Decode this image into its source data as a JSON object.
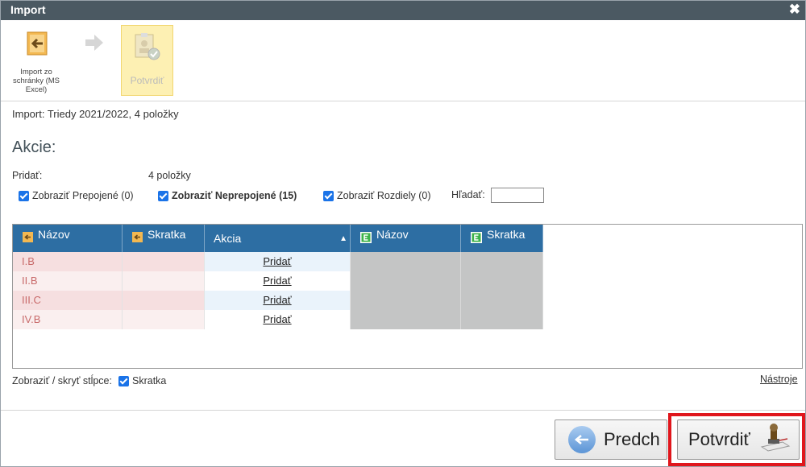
{
  "window": {
    "title": "Import",
    "close_glyph": "✖"
  },
  "toolbar": {
    "import_label": "Import zo schránky (MS Excel)",
    "import_icon": "import-arrow-icon",
    "next_icon": "arrow-right-icon",
    "confirm_label": "Potvrdiť",
    "confirm_icon": "stamp-document-icon"
  },
  "info": {
    "text": "Import: Triedy 2021/2022, 4 položky"
  },
  "actions": {
    "heading": "Akcie:",
    "add_label": "Pridať:",
    "add_count": "4 položky"
  },
  "filters": {
    "show_linked": "Zobraziť Prepojené (0)",
    "show_unlinked": "Zobraziť Neprepojené (15)",
    "show_differences": "Zobraziť Rozdiely (0)",
    "search_label": "Hľadať:",
    "search_value": ""
  },
  "grid": {
    "columns": [
      {
        "label": "Názov",
        "icon": "source-import-icon"
      },
      {
        "label": "Skratka",
        "icon": "source-import-icon"
      },
      {
        "label": "Akcia",
        "sort": "▲"
      },
      {
        "label": "Názov",
        "icon": "edupage-e-icon"
      },
      {
        "label": "Skratka",
        "icon": "edupage-e-icon"
      }
    ],
    "rows": [
      {
        "name": "I.B",
        "action": "Pridať"
      },
      {
        "name": "II.B",
        "action": "Pridať"
      },
      {
        "name": "III.C",
        "action": "Pridať"
      },
      {
        "name": "IV.B",
        "action": "Pridať"
      }
    ]
  },
  "columns_toggle": {
    "label": "Zobraziť / skryť stĺpce:",
    "option": "Skratka"
  },
  "tools_link": "Nástroje",
  "footer": {
    "prev_label": "Predch",
    "confirm_label": "Potvrdiť"
  },
  "colors": {
    "header": "#2d6ea3",
    "titlebar": "#4b5962",
    "highlight": "#e0161c",
    "row_name": "#c86a6a"
  }
}
